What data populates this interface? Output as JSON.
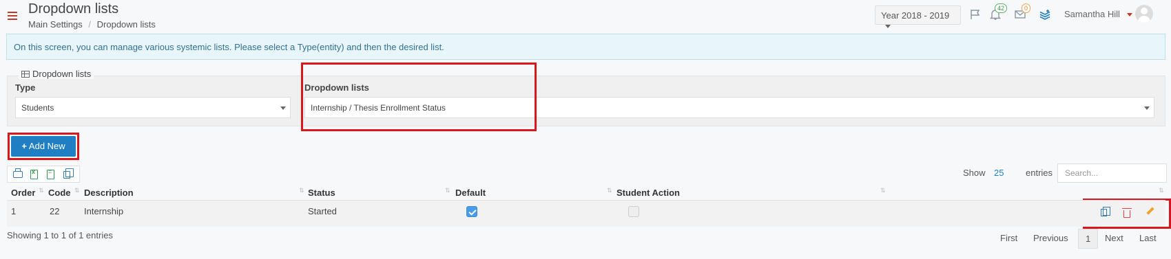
{
  "header": {
    "title": "Dropdown lists",
    "breadcrumb": [
      "Main Settings",
      "/",
      "Dropdown lists"
    ],
    "year_selector": "Year 2018 - 2019",
    "notifications_count": "42",
    "messages_count": "0",
    "user_name": "Samantha Hill"
  },
  "info": {
    "message": "On this screen, you can manage various systemic lists. Please select a Type(entity) and then the desired list."
  },
  "filters": {
    "legend": "Dropdown lists",
    "type_label": "Type",
    "type_value": "Students",
    "list_label": "Dropdown lists",
    "list_value": "Internship / Thesis Enrollment Status"
  },
  "toolbar": {
    "add_new_label": "Add New",
    "show_label": "Show",
    "show_value": "25",
    "entries_label": "entries",
    "search_placeholder": "Search..."
  },
  "table": {
    "columns": [
      "Order",
      "Code",
      "Description",
      "Status",
      "Default",
      "Student Action"
    ],
    "rows": [
      {
        "order": "1",
        "code": "22",
        "description": "Internship",
        "status": "Started",
        "default": true,
        "student_action": false
      }
    ]
  },
  "footer": {
    "showing_text": "Showing 1 to 1 of 1 entries",
    "pagination": {
      "first": "First",
      "previous": "Previous",
      "current": "1",
      "next": "Next",
      "last": "Last"
    }
  },
  "colors": {
    "primary": "#1f7fc2",
    "highlight": "#d9161c",
    "info_bg": "#e8f6fb"
  }
}
